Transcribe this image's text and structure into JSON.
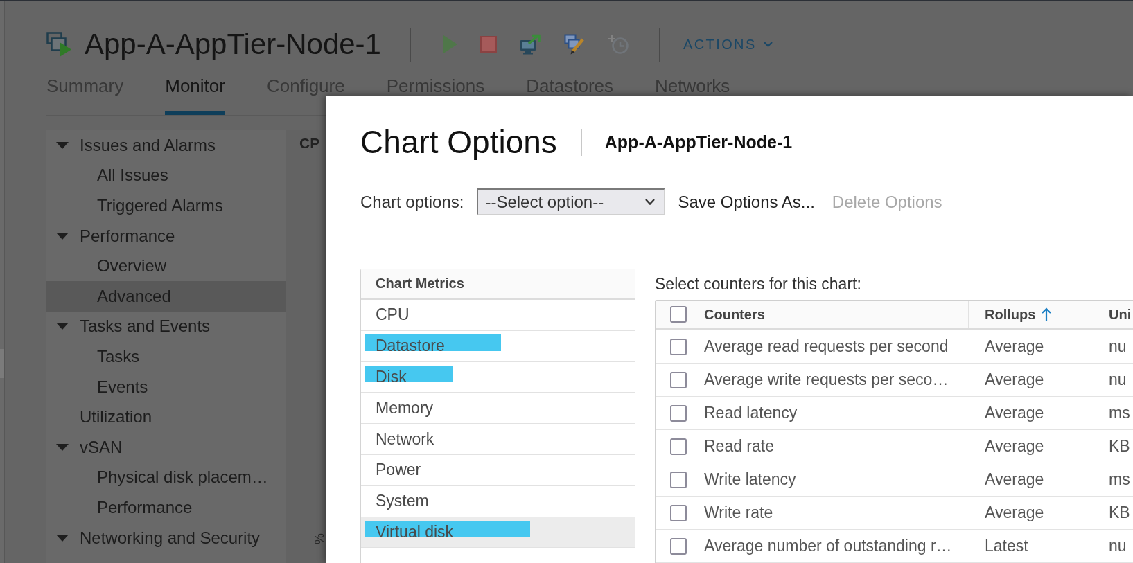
{
  "header": {
    "title": "App-A-AppTier-Node-1",
    "toolbar": [
      {
        "kind": "power-on",
        "disabled": true
      },
      {
        "kind": "power-off",
        "disabled": false
      },
      {
        "kind": "console",
        "disabled": false
      },
      {
        "kind": "edit",
        "disabled": false
      },
      {
        "kind": "snapshot",
        "disabled": true
      }
    ],
    "actions_menu": {
      "label": "ACTIONS"
    }
  },
  "tabs": [
    {
      "label": "Summary",
      "selected": false
    },
    {
      "label": "Monitor",
      "selected": true
    },
    {
      "label": "Configure",
      "selected": false
    },
    {
      "label": "Permissions",
      "selected": false
    },
    {
      "label": "Datastores",
      "selected": false
    },
    {
      "label": "Networks",
      "selected": false
    }
  ],
  "sidebar": {
    "items": [
      {
        "label": "Issues and Alarms",
        "expanded": true,
        "selected": false,
        "children": [
          {
            "label": "All Issues",
            "selected": false
          },
          {
            "label": "Triggered Alarms",
            "selected": false
          }
        ]
      },
      {
        "label": "Performance",
        "expanded": true,
        "selected": false,
        "children": [
          {
            "label": "Overview",
            "selected": false
          },
          {
            "label": "Advanced",
            "selected": true
          }
        ]
      },
      {
        "label": "Tasks and Events",
        "expanded": true,
        "selected": false,
        "children": [
          {
            "label": "Tasks",
            "selected": false
          },
          {
            "label": "Events",
            "selected": false
          }
        ]
      },
      {
        "label": "Utilization",
        "selected": false
      },
      {
        "label": "vSAN",
        "expanded": true,
        "selected": false,
        "children": [
          {
            "label": "Physical disk placem…",
            "selected": false
          },
          {
            "label": "Performance",
            "selected": false
          }
        ]
      },
      {
        "label": "Networking and Security",
        "expanded": true,
        "selected": false
      }
    ]
  },
  "content": {
    "chart_title": "CP",
    "axis_label": "%"
  },
  "dialog": {
    "title": "Chart Options",
    "subtitle": "App-A-AppTier-Node-1",
    "options_row": {
      "label": "Chart options:",
      "select": {
        "value": "--Select option--"
      },
      "buttons": [
        {
          "label": "Save Options As...",
          "disabled": false
        },
        {
          "label": "Delete Options",
          "disabled": true
        }
      ]
    },
    "metrics": {
      "header": "Chart Metrics",
      "items": [
        {
          "label": "CPU",
          "selected": false,
          "highlighted": false
        },
        {
          "label": "Datastore",
          "selected": false,
          "highlighted": true
        },
        {
          "label": "Disk",
          "selected": false,
          "highlighted": true
        },
        {
          "label": "Memory",
          "selected": false,
          "highlighted": false
        },
        {
          "label": "Network",
          "selected": false,
          "highlighted": false
        },
        {
          "label": "Power",
          "selected": false,
          "highlighted": false
        },
        {
          "label": "System",
          "selected": false,
          "highlighted": false
        },
        {
          "label": "Virtual disk",
          "selected": true,
          "highlighted": true
        }
      ]
    },
    "counters": {
      "caption": "Select counters for this chart:",
      "select_all_checked": false,
      "columns": [
        {
          "label": "Counters",
          "sorted": false
        },
        {
          "label": "Rollups",
          "sorted": true
        },
        {
          "label": "Uni",
          "sorted": false
        }
      ],
      "rows": [
        {
          "checked": false,
          "counter": "Average read requests per second",
          "rollup": "Average",
          "units": "nu"
        },
        {
          "checked": false,
          "counter": "Average write requests per seco…",
          "rollup": "Average",
          "units": "nu"
        },
        {
          "checked": false,
          "counter": "Read latency",
          "rollup": "Average",
          "units": "ms"
        },
        {
          "checked": false,
          "counter": "Read rate",
          "rollup": "Average",
          "units": "KB"
        },
        {
          "checked": false,
          "counter": "Write latency",
          "rollup": "Average",
          "units": "ms"
        },
        {
          "checked": false,
          "counter": "Write rate",
          "rollup": "Average",
          "units": "KB"
        },
        {
          "checked": false,
          "counter": "Average number of outstanding r…",
          "rollup": "Latest",
          "units": "nu"
        }
      ]
    }
  }
}
